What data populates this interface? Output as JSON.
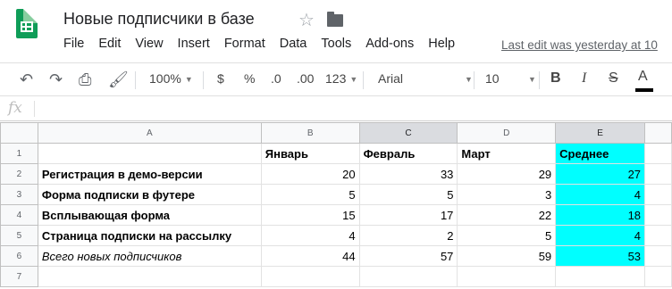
{
  "document": {
    "title": "Новые подписчики в базе",
    "star_icon": "star-icon",
    "folder_icon": "folder-icon"
  },
  "menu": {
    "items": [
      "File",
      "Edit",
      "View",
      "Insert",
      "Format",
      "Data",
      "Tools",
      "Add-ons",
      "Help"
    ],
    "last_edit": "Last edit was yesterday at 10"
  },
  "toolbar": {
    "zoom": "100%",
    "currency": "$",
    "percent": "%",
    "decrease_decimals": ".0",
    "increase_decimals": ".00",
    "more_formats": "123",
    "font": "Arial",
    "font_size": "10",
    "bold": "B",
    "italic": "I",
    "strikethrough": "S",
    "text_color": "A"
  },
  "formula_bar": {
    "label": "fx",
    "value": ""
  },
  "sheet": {
    "columns": [
      "A",
      "B",
      "C",
      "D",
      "E"
    ],
    "rows": [
      "1",
      "2",
      "3",
      "4",
      "5",
      "6",
      "7"
    ],
    "header": [
      "",
      "Январь",
      "Февраль",
      "Март",
      "Среднее"
    ],
    "data": [
      [
        "Регистрация в демо-версии",
        "20",
        "33",
        "29",
        "27"
      ],
      [
        "Форма подписки в футере",
        "5",
        "5",
        "3",
        "4"
      ],
      [
        "Всплывающая форма",
        "15",
        "17",
        "22",
        "18"
      ],
      [
        "Страница подписки на рассылку",
        "4",
        "2",
        "5",
        "4"
      ]
    ],
    "total": [
      "Всего новых подписчиков",
      "44",
      "57",
      "59",
      "53"
    ],
    "highlight_color": "#00ffff"
  }
}
